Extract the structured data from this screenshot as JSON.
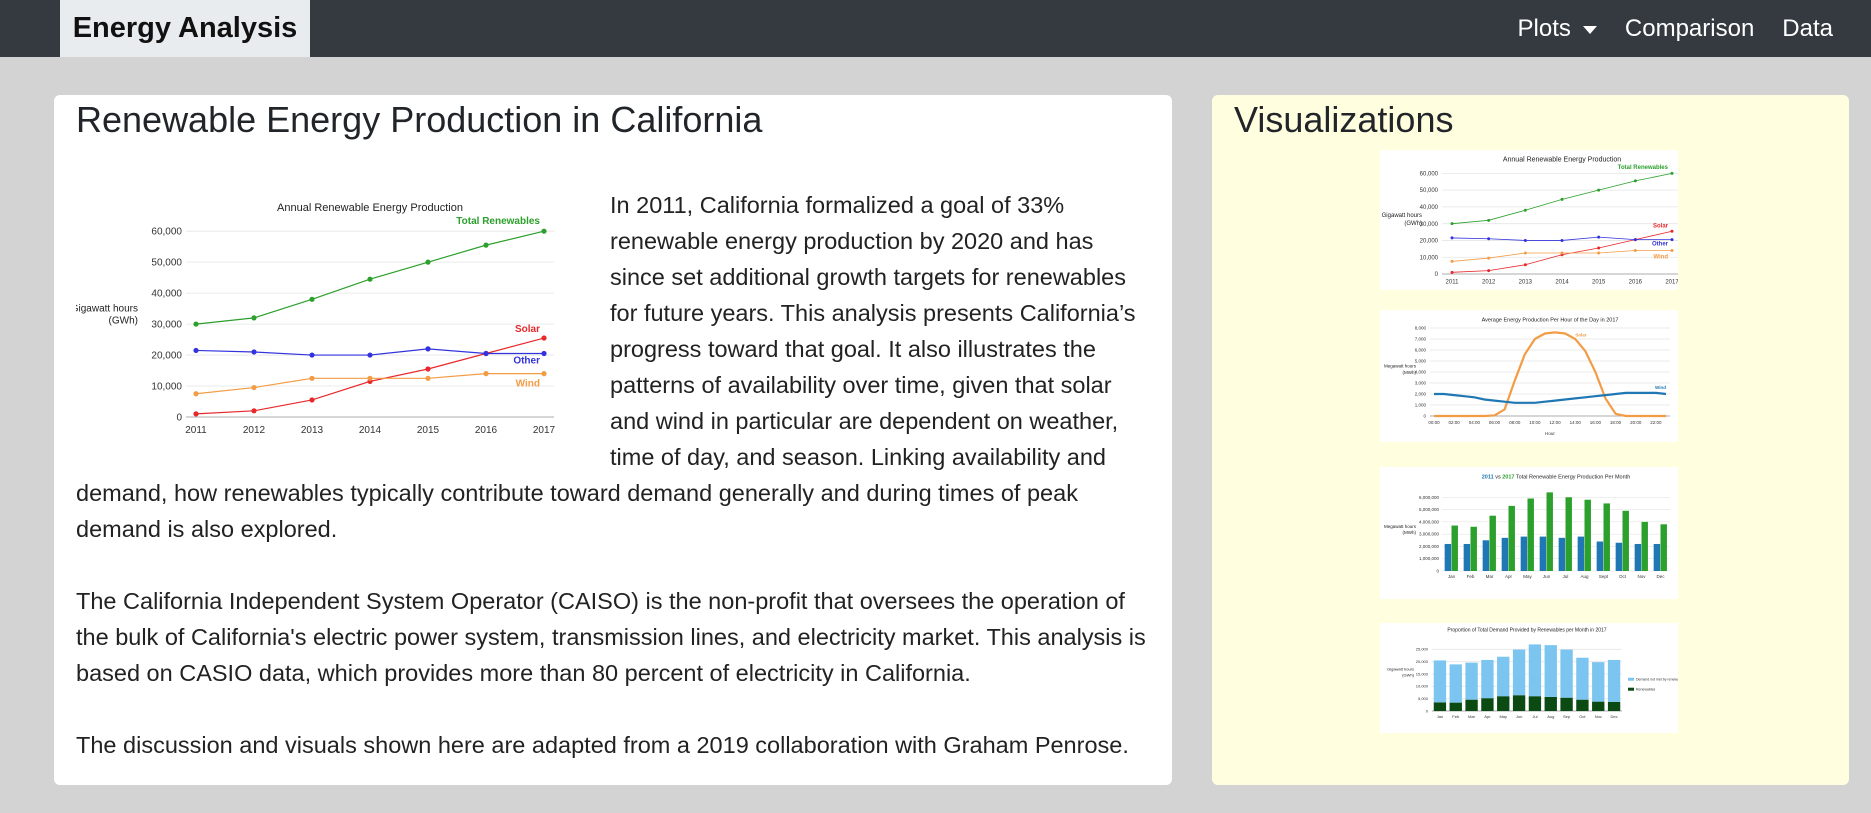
{
  "nav": {
    "brand": "Energy Analysis",
    "items": [
      {
        "label": "Plots",
        "dropdown": true
      },
      {
        "label": "Comparison"
      },
      {
        "label": "Data"
      }
    ]
  },
  "main": {
    "title": "Renewable Energy Production in California",
    "paragraphs": [
      "In 2011, California formalized a goal of 33% renewable energy production by 2020 and has since set additional growth targets for renewables for future years. This analysis presents California’s progress toward that goal. It also illustrates the patterns of availability over time, given that solar and wind in particular are dependent on weather, time of day, and season. Linking availability and demand, how renewables typically contribute toward demand generally and during times of peak demand is also explored.",
      "The California Independent System Operator (CAISO) is the non-profit that oversees the operation of the bulk of California's electric power system, transmission lines, and electricity market. This analysis is based on CASIO data, which provides more than 80 percent of electricity in California.",
      "The discussion and visuals shown here are adapted from a 2019 collaboration with Graham Penrose."
    ]
  },
  "side": {
    "title": "Visualizations"
  },
  "colors": {
    "navbar": "#343a40",
    "side_bg": "#ffffe0",
    "total": "#2ca02c",
    "solar": "#e8282b",
    "other": "#3333dd",
    "wind": "#f39c45",
    "blue": "#1f77b4",
    "green": "#2ca02c",
    "light_blue": "#7cc5f0",
    "dark_green": "#0b4a12"
  },
  "chart_data": [
    {
      "type": "line",
      "title": "Annual Renewable Energy Production",
      "ylabel": "Gigawatt hours (GWh)",
      "xlabel": "",
      "x": [
        2011,
        2012,
        2013,
        2014,
        2015,
        2016,
        2017
      ],
      "ylim": [
        0,
        62000
      ],
      "yticks": [
        "0",
        "10,000",
        "20,000",
        "30,000",
        "40,000",
        "50,000",
        "60,000"
      ],
      "series": [
        {
          "name": "Total Renewables",
          "color": "#2ca02c",
          "values": [
            30000,
            32000,
            38000,
            44500,
            50000,
            55500,
            60000
          ]
        },
        {
          "name": "Solar",
          "color": "#e8282b",
          "values": [
            1000,
            2000,
            5500,
            11500,
            15500,
            20500,
            25500
          ]
        },
        {
          "name": "Other",
          "color": "#3333dd",
          "values": [
            21500,
            21000,
            20000,
            20000,
            22000,
            20500,
            20500
          ]
        },
        {
          "name": "Wind",
          "color": "#f39c45",
          "values": [
            7500,
            9500,
            12500,
            12500,
            12500,
            14000,
            14000
          ]
        }
      ]
    },
    {
      "type": "line",
      "title": "Average Energy Production Per Hour of the Day in 2017",
      "ylabel": "Megawatt hours (MWh)",
      "xlabel": "Hour",
      "x": [
        "00:00",
        "01:00",
        "02:00",
        "03:00",
        "04:00",
        "05:00",
        "06:00",
        "07:00",
        "08:00",
        "09:00",
        "10:00",
        "11:00",
        "12:00",
        "13:00",
        "14:00",
        "15:00",
        "16:00",
        "17:00",
        "18:00",
        "19:00",
        "20:00",
        "21:00",
        "22:00",
        "23:00"
      ],
      "xticks": [
        "00:00",
        "02:00",
        "04:00",
        "06:00",
        "08:00",
        "10:00",
        "12:00",
        "14:00",
        "16:00",
        "18:00",
        "20:00",
        "22:00"
      ],
      "ylim": [
        0,
        8000
      ],
      "yticks": [
        "0",
        "1,000",
        "2,000",
        "3,000",
        "4,000",
        "5,000",
        "6,000",
        "7,000",
        "8,000"
      ],
      "series": [
        {
          "name": "Solar",
          "color": "#f39c45",
          "values": [
            0,
            0,
            0,
            0,
            0,
            0,
            50,
            600,
            3200,
            5600,
            7000,
            7500,
            7600,
            7500,
            7000,
            5900,
            4000,
            1600,
            200,
            0,
            0,
            0,
            0,
            0
          ]
        },
        {
          "name": "Wind",
          "color": "#1f77b4",
          "values": [
            2000,
            2000,
            1900,
            1800,
            1700,
            1500,
            1400,
            1300,
            1200,
            1200,
            1200,
            1300,
            1400,
            1500,
            1600,
            1700,
            1800,
            1900,
            2000,
            2100,
            2100,
            2100,
            2100,
            2000
          ]
        }
      ]
    },
    {
      "type": "bar",
      "title": "2011 vs 2017 Total Renewable Energy Production Per Month",
      "title_parts": [
        "2011",
        " vs ",
        "2017",
        " Total Renewable Energy Production Per Month"
      ],
      "ylabel": "Megawatt hours (MWh)",
      "categories": [
        "Jan",
        "Feb",
        "Mar",
        "Apr",
        "May",
        "Jun",
        "Jul",
        "Aug",
        "Sept",
        "Oct",
        "Nov",
        "Dec"
      ],
      "ylim": [
        0,
        7000000
      ],
      "yticks": [
        "0",
        "1,000,000",
        "2,000,000",
        "3,000,000",
        "4,000,000",
        "5,000,000",
        "6,000,000"
      ],
      "series": [
        {
          "name": "2011",
          "color": "#1f77b4",
          "values": [
            2200000,
            2200000,
            2500000,
            2700000,
            2800000,
            2800000,
            2700000,
            2800000,
            2400000,
            2300000,
            2200000,
            2200000
          ]
        },
        {
          "name": "2017",
          "color": "#2ca02c",
          "values": [
            3700000,
            3600000,
            4500000,
            5300000,
            5900000,
            6400000,
            6000000,
            5800000,
            5500000,
            4900000,
            4000000,
            3800000
          ]
        }
      ]
    },
    {
      "type": "bar",
      "title": "Proportion of Total Demand Provided by Renewables per Month in 2017",
      "ylabel": "Gigawatt hours (GWh)",
      "categories": [
        "Jan",
        "Feb",
        "Mar",
        "Apr",
        "May",
        "Jun",
        "Jul",
        "Aug",
        "Sep",
        "Oct",
        "Nov",
        "Dec"
      ],
      "ylim": [
        0,
        30000
      ],
      "yticks": [
        "0",
        "5,000",
        "10,000",
        "15,000",
        "20,000",
        "25,000"
      ],
      "series": [
        {
          "name": "Demand not met by renewables",
          "color": "#7cc5f0",
          "values": [
            17000,
            15500,
            15000,
            15500,
            16000,
            18500,
            21000,
            21000,
            19500,
            17000,
            16000,
            17000
          ]
        },
        {
          "name": "Renewables",
          "color": "#0b4a12",
          "values": [
            3500,
            3400,
            4600,
            5200,
            6000,
            6400,
            6000,
            5700,
            5400,
            4600,
            3800,
            3700
          ]
        }
      ]
    }
  ]
}
